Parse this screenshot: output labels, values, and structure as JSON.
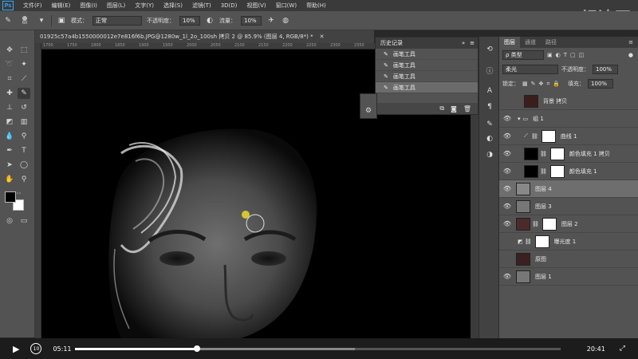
{
  "app": {
    "logo": "Ps"
  },
  "menu": [
    "文件(F)",
    "编辑(E)",
    "图像(I)",
    "图层(L)",
    "文字(Y)",
    "选择(S)",
    "滤镜(T)",
    "3D(D)",
    "视图(V)",
    "窗口(W)",
    "帮助(H)"
  ],
  "watermark": "视达网",
  "options": {
    "brush_size": "60",
    "mode_label": "模式：",
    "mode_value": "正常",
    "opacity_label": "不透明度：",
    "opacity_value": "10%",
    "flow_label": "流量：",
    "flow_value": "10%"
  },
  "document": {
    "tab_title": "01925c57a4b1550000012e7e816f6b.JPG@1280w_1l_2o_100sh 拷贝 2 @ 85.9% (图层 4, RGB/8*) *",
    "ruler_ticks": [
      "1700",
      "1750",
      "1800",
      "1850",
      "1900",
      "1950",
      "2000",
      "2050",
      "2100",
      "2150",
      "2200",
      "2250",
      "2300",
      "2350",
      "2400",
      "2450",
      "2500",
      "2550"
    ]
  },
  "history": {
    "title": "历史记录",
    "items": [
      "画笔工具",
      "画笔工具",
      "画笔工具",
      "画笔工具"
    ],
    "selected_index": 3
  },
  "layers_panel": {
    "tabs": [
      "图层",
      "通道",
      "路径"
    ],
    "active_tab": 0,
    "filter_label": "ρ 类型",
    "blend_mode": "柔光",
    "opacity_label": "不透明度：",
    "opacity_value": "100%",
    "lock_label": "锁定：",
    "fill_label": "填充：",
    "fill_value": "100%",
    "layers": [
      {
        "name": "背景 拷贝",
        "visible": false,
        "selected": false
      },
      {
        "name": "组 1",
        "visible": true,
        "selected": false
      },
      {
        "name": "曲线 1",
        "visible": true,
        "selected": false
      },
      {
        "name": "颜色填充 1 拷贝",
        "visible": true,
        "selected": false
      },
      {
        "name": "颜色填充 1",
        "visible": true,
        "selected": false
      },
      {
        "name": "图层 4",
        "visible": true,
        "selected": true
      },
      {
        "name": "图层 3",
        "visible": true,
        "selected": false
      },
      {
        "name": "图层 2",
        "visible": true,
        "selected": false
      },
      {
        "name": "曝光度 1",
        "visible": false,
        "selected": false
      },
      {
        "name": "原图",
        "visible": false,
        "selected": false
      },
      {
        "name": "图层 1",
        "visible": true,
        "selected": false
      }
    ]
  },
  "video": {
    "current_time": "05:11",
    "total_time": "20:41",
    "played_fraction": 0.251,
    "buffered_fraction": 0.577,
    "skip_label": "10"
  },
  "colors": {
    "accent_blue": "#31a8ff",
    "brush_dot": "#d4c630",
    "panel_bg": "#535353"
  }
}
